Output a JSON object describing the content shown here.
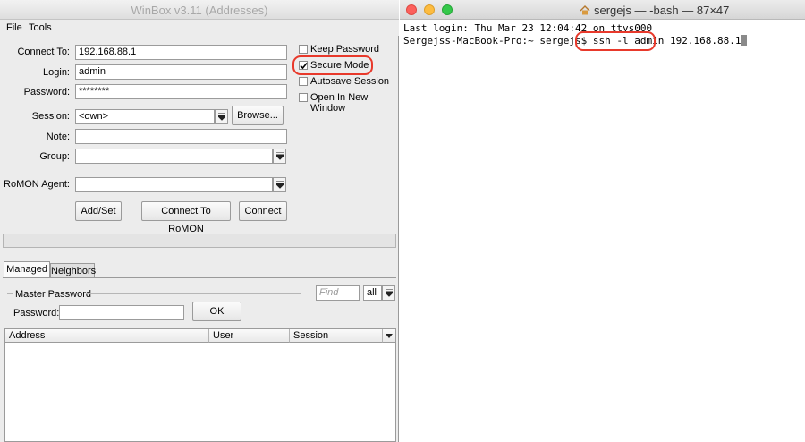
{
  "winbox": {
    "title": "WinBox v3.11 (Addresses)",
    "menu": [
      "File",
      "Tools"
    ],
    "form": {
      "connect_to_label": "Connect To:",
      "connect_to_value": "192.168.88.1",
      "login_label": "Login:",
      "login_value": "admin",
      "password_label": "Password:",
      "password_value": "********",
      "session_label": "Session:",
      "session_value": "<own>",
      "browse_label": "Browse...",
      "note_label": "Note:",
      "note_value": "",
      "group_label": "Group:",
      "group_value": "",
      "romon_label": "RoMON Agent:",
      "romon_value": ""
    },
    "options": [
      {
        "label": "Keep Password",
        "checked": false
      },
      {
        "label": "Secure Mode",
        "checked": true
      },
      {
        "label": "Autosave Session",
        "checked": false
      },
      {
        "label": "Open In New Window",
        "checked": false
      }
    ],
    "buttons": {
      "add_set": "Add/Set",
      "connect_romon": "Connect To RoMON",
      "connect": "Connect"
    },
    "tabs": [
      {
        "label": "Managed",
        "active": true
      },
      {
        "label": "Neighbors",
        "active": false
      }
    ],
    "master_password": {
      "group_label": "Master Password",
      "password_label": "Password:",
      "password_value": "",
      "ok_label": "OK"
    },
    "find": {
      "placeholder": "Find",
      "filter_value": "all"
    },
    "table": {
      "columns": [
        "Address",
        "User",
        "Session"
      ],
      "rows": []
    }
  },
  "terminal": {
    "title": "sergejs — -bash — 87×47",
    "lines": [
      "Last login: Thu Mar 23 12:04:42 on ttys000",
      "Sergejss-MacBook-Pro:~ sergejs$ ssh -l admin 192.168.88.1"
    ],
    "prompt": "Sergejss-MacBook-Pro:~ sergejs$ ",
    "command": "ssh -l admin",
    "argument": " 192.168.88.1"
  },
  "colors": {
    "highlight_oval": "#e8392b",
    "traffic_close": "#fc605c",
    "traffic_minimize": "#fdbc40",
    "traffic_zoom": "#34c84a"
  },
  "icons": [
    "checkmark-icon",
    "dropdown-arrow-icon",
    "home-icon",
    "column-menu-icon"
  ]
}
